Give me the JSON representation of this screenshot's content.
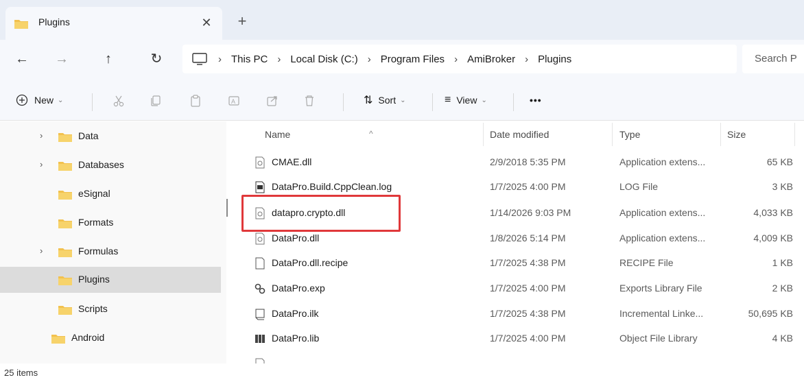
{
  "tab": {
    "title": "Plugins",
    "close_glyph": "✕",
    "new_glyph": "+"
  },
  "nav_buttons": {
    "back": "←",
    "forward": "→",
    "up": "↑",
    "refresh": "↻"
  },
  "breadcrumb": [
    "This PC",
    "Local Disk (C:)",
    "Program Files",
    "AmiBroker",
    "Plugins"
  ],
  "search": {
    "placeholder": "Search P"
  },
  "toolbar": {
    "new_label": "New",
    "sort_label": "Sort",
    "view_label": "View",
    "more_label": "•••",
    "icons": [
      "cut-icon",
      "copy-icon",
      "paste-icon",
      "rename-icon",
      "share-icon",
      "delete-icon"
    ]
  },
  "nav_pane": {
    "items": [
      {
        "label": "Data",
        "expandable": true
      },
      {
        "label": "Databases",
        "expandable": true
      },
      {
        "label": "eSignal",
        "expandable": false
      },
      {
        "label": "Formats",
        "expandable": false
      },
      {
        "label": "Formulas",
        "expandable": true
      },
      {
        "label": "Plugins",
        "expandable": false,
        "selected": true
      },
      {
        "label": "Scripts",
        "expandable": false
      },
      {
        "label": "Android",
        "expandable": false
      }
    ]
  },
  "columns": {
    "name": "Name",
    "date": "Date modified",
    "type": "Type",
    "size": "Size"
  },
  "files": [
    {
      "name": "CMAE.dll",
      "date": "2/9/2018 5:35 PM",
      "type": "Application extens...",
      "size": "65 KB",
      "icon": "dll-icon"
    },
    {
      "name": "DataPro.Build.CppClean.log",
      "date": "1/7/2025 4:00 PM",
      "type": "LOG File",
      "size": "3 KB",
      "icon": "log-icon"
    },
    {
      "name": "datapro.crypto.dll",
      "date": "1/14/2026 9:03 PM",
      "type": "Application extens...",
      "size": "4,033 KB",
      "icon": "dll-icon"
    },
    {
      "name": "DataPro.dll",
      "date": "1/8/2026 5:14 PM",
      "type": "Application extens...",
      "size": "4,009 KB",
      "icon": "dll-icon"
    },
    {
      "name": "DataPro.dll.recipe",
      "date": "1/7/2025 4:38 PM",
      "type": "RECIPE File",
      "size": "1 KB",
      "icon": "file-icon"
    },
    {
      "name": "DataPro.exp",
      "date": "1/7/2025 4:00 PM",
      "type": "Exports Library File",
      "size": "2 KB",
      "icon": "exp-icon"
    },
    {
      "name": "DataPro.ilk",
      "date": "1/7/2025 4:38 PM",
      "type": "Incremental Linke...",
      "size": "50,695 KB",
      "icon": "ilk-icon"
    },
    {
      "name": "DataPro.lib",
      "date": "1/7/2025 4:00 PM",
      "type": "Object File Library",
      "size": "4 KB",
      "icon": "lib-icon"
    }
  ],
  "status": {
    "items_count": "25 items"
  },
  "colors": {
    "highlight": "#e0383a",
    "folder": "#f2c14e",
    "selected_nav": "#dcdcdc"
  }
}
